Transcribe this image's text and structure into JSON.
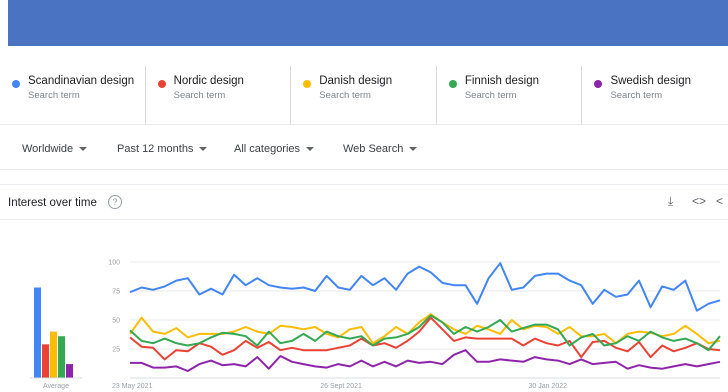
{
  "terms": [
    {
      "label": "Scandinavian design",
      "sub": "Search term",
      "color": "#4285f4"
    },
    {
      "label": "Nordic design",
      "sub": "Search term",
      "color": "#ea4335"
    },
    {
      "label": "Danish design",
      "sub": "Search term",
      "color": "#fbbc04"
    },
    {
      "label": "Finnish design",
      "sub": "Search term",
      "color": "#34a853"
    },
    {
      "label": "Swedish design",
      "sub": "Search term",
      "color": "#8e24aa"
    }
  ],
  "filters": {
    "region": "Worldwide",
    "period": "Past 12 months",
    "category": "All categories",
    "search_type": "Web Search"
  },
  "interest": {
    "title": "Interest over time",
    "help_icon": "question-circle-icon",
    "download_icon": "download-icon",
    "embed_icon": "code-icon",
    "share_icon": "share-icon"
  },
  "chart_data": {
    "type": "line",
    "ylim": [
      0,
      100
    ],
    "grid": true,
    "y_ticks": [
      {
        "label": "100",
        "value": 100
      },
      {
        "label": "75",
        "value": 75
      },
      {
        "label": "50",
        "value": 50
      },
      {
        "label": "25",
        "value": 25
      }
    ],
    "x_ticks": [
      {
        "label": "23 May 2021",
        "index": 0
      },
      {
        "label": "26 Sept 2021",
        "index": 18
      },
      {
        "label": "30 Jan 2022",
        "index": 36
      }
    ],
    "average_label": "Average",
    "averages": [
      {
        "name": "Scandinavian design",
        "value": 78,
        "color": "#4285f4"
      },
      {
        "name": "Nordic design",
        "value": 29,
        "color": "#ea4335"
      },
      {
        "name": "Danish design",
        "value": 40,
        "color": "#fbbc04"
      },
      {
        "name": "Finnish design",
        "value": 36,
        "color": "#34a853"
      },
      {
        "name": "Swedish design",
        "value": 12,
        "color": "#8e24aa"
      }
    ],
    "series": [
      {
        "name": "Scandinavian design",
        "color": "#4285f4",
        "values": [
          74,
          78,
          76,
          79,
          84,
          86,
          72,
          77,
          72,
          89,
          80,
          86,
          80,
          78,
          77,
          78,
          75,
          88,
          78,
          76,
          88,
          80,
          86,
          76,
          90,
          96,
          91,
          82,
          80,
          80,
          64,
          86,
          99,
          76,
          78,
          88,
          90,
          90,
          84,
          80,
          64,
          76,
          70,
          72,
          84,
          61,
          79,
          76,
          84,
          58,
          64,
          67
        ]
      },
      {
        "name": "Nordic design",
        "color": "#ea4335",
        "values": [
          35,
          27,
          26,
          16,
          24,
          23,
          30,
          27,
          20,
          24,
          32,
          26,
          31,
          24,
          26,
          24,
          24,
          24,
          26,
          28,
          34,
          28,
          30,
          26,
          32,
          40,
          52,
          42,
          32,
          35,
          34,
          34,
          34,
          34,
          28,
          34,
          30,
          28,
          32,
          18,
          31,
          32,
          26,
          23,
          31,
          18,
          28,
          23,
          26,
          30,
          25,
          24
        ]
      },
      {
        "name": "Danish design",
        "color": "#fbbc04",
        "values": [
          38,
          52,
          40,
          38,
          43,
          35,
          38,
          38,
          38,
          40,
          44,
          40,
          38,
          45,
          44,
          42,
          44,
          38,
          35,
          42,
          44,
          30,
          36,
          44,
          38,
          48,
          55,
          48,
          42,
          38,
          45,
          42,
          38,
          50,
          42,
          45,
          44,
          38,
          44,
          36,
          36,
          38,
          30,
          38,
          40,
          39,
          36,
          38,
          45,
          38,
          30,
          32
        ]
      },
      {
        "name": "Finnish design",
        "color": "#34a853",
        "values": [
          41,
          32,
          30,
          34,
          30,
          28,
          30,
          35,
          39,
          38,
          36,
          28,
          40,
          30,
          32,
          38,
          32,
          40,
          36,
          34,
          36,
          28,
          34,
          35,
          38,
          44,
          54,
          48,
          38,
          44,
          40,
          44,
          50,
          40,
          43,
          46,
          46,
          42,
          28,
          35,
          38,
          28,
          30,
          36,
          32,
          40,
          35,
          32,
          34,
          30,
          24,
          36
        ]
      },
      {
        "name": "Swedish design",
        "color": "#8e24aa",
        "values": [
          13,
          13,
          9,
          9,
          10,
          6,
          12,
          15,
          11,
          12,
          10,
          18,
          8,
          19,
          14,
          12,
          10,
          9,
          12,
          10,
          15,
          10,
          14,
          10,
          15,
          13,
          14,
          12,
          20,
          24,
          14,
          14,
          16,
          15,
          14,
          18,
          16,
          15,
          12,
          16,
          12,
          13,
          14,
          8,
          11,
          9,
          8,
          10,
          12,
          10,
          12,
          14
        ]
      }
    ]
  }
}
